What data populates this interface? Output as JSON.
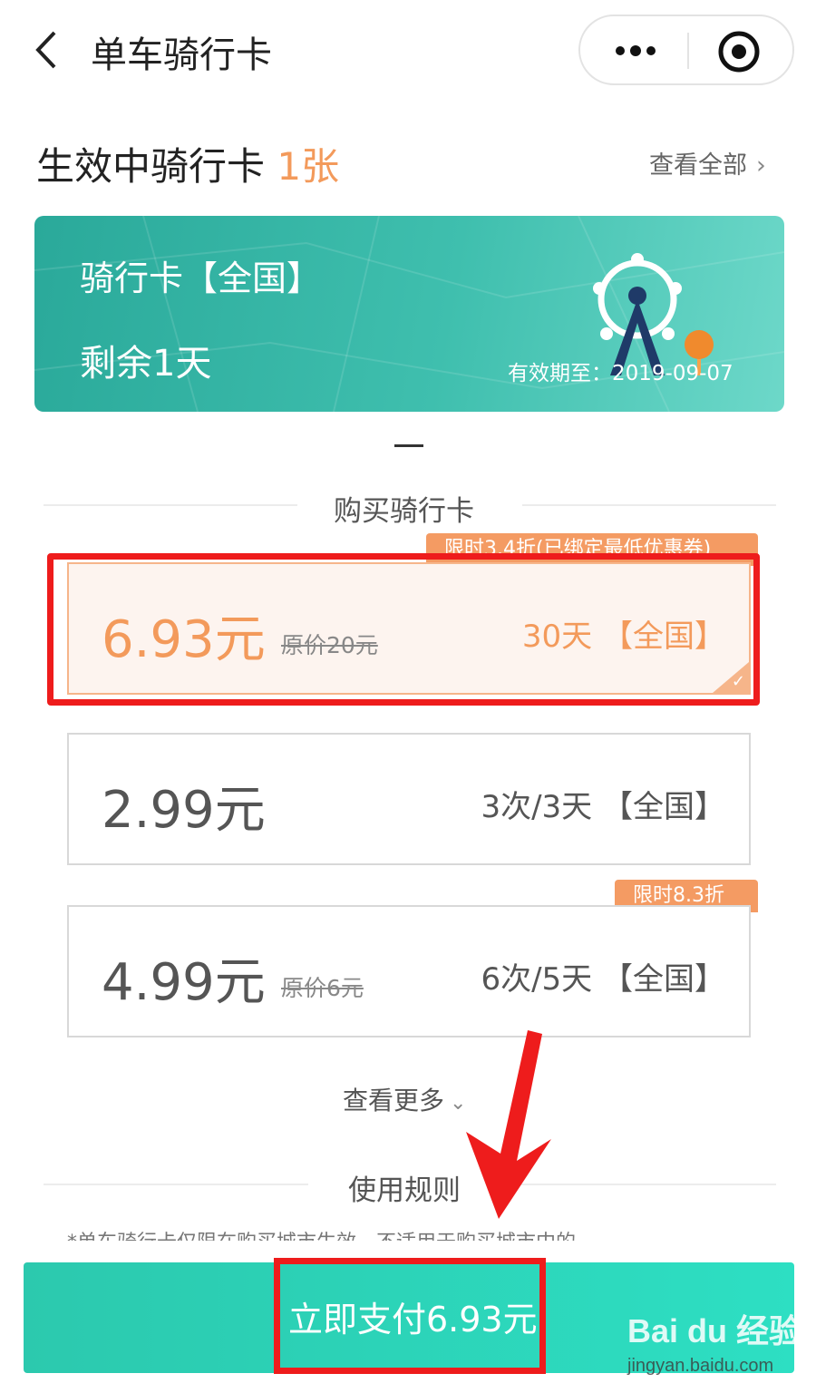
{
  "header": {
    "title": "单车骑行卡"
  },
  "active": {
    "title": "生效中骑行卡",
    "count": "1张",
    "view_all": "查看全部"
  },
  "card": {
    "name": "骑行卡【全国】",
    "remaining": "剩余1天",
    "valid_until": "有效期至：2019-09-07"
  },
  "buy_section": {
    "title": "购买骑行卡"
  },
  "options": [
    {
      "price": "6.93元",
      "original": "原价20元",
      "desc": "30天 【全国】",
      "tag": "限时3.4折(已绑定最低优惠券)",
      "selected": true
    },
    {
      "price": "2.99元",
      "original": "",
      "desc": "3次/3天 【全国】",
      "tag": "",
      "selected": false
    },
    {
      "price": "4.99元",
      "original": "原价6元",
      "desc": "6次/5天 【全国】",
      "tag": "限时8.3折",
      "selected": false
    }
  ],
  "more_label": "查看更多",
  "rules": {
    "title": "使用规则",
    "text": "*单车骑行卡仅限在购买城市生效，不适用于购买城市中的"
  },
  "pay": {
    "label": "立即支付6.93元"
  },
  "watermark": {
    "logo": "Bai du 经验",
    "url": "jingyan.baidu.com"
  },
  "colors": {
    "accent_orange": "#f39a5b",
    "teal": "#2aa99a",
    "pay_button": "#2dd4b8",
    "annotation_red": "#ee1c1c"
  }
}
